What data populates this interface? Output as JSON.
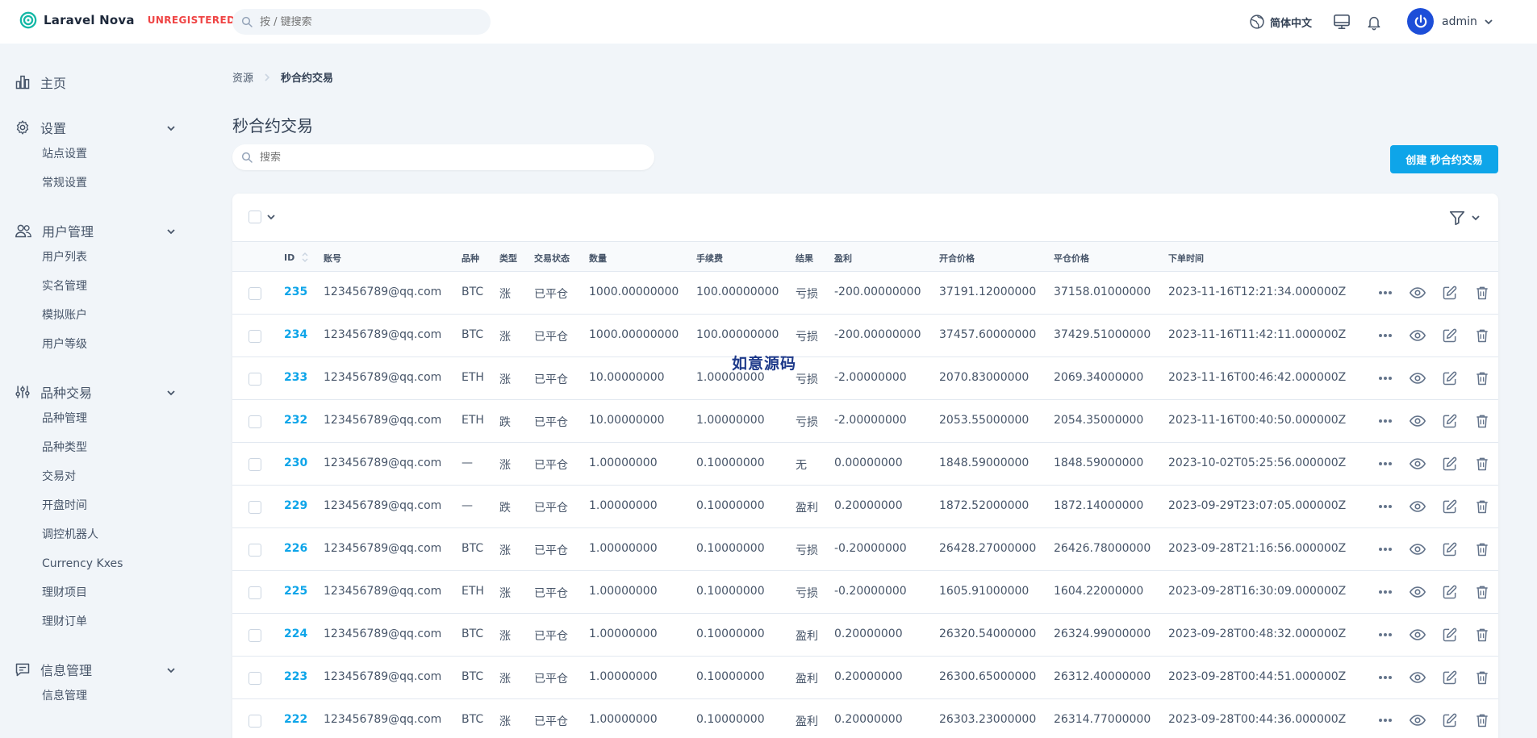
{
  "app": {
    "name": "Laravel Nova",
    "badge": "UNREGISTERED"
  },
  "topbar": {
    "search_placeholder": "按 / 键搜索",
    "language": "简体中文",
    "user_name": "admin"
  },
  "sidebar": {
    "groups": [
      {
        "label": "主页",
        "icon": "chart-bar-icon",
        "items": []
      },
      {
        "label": "设置",
        "icon": "gear-icon",
        "items": [
          "站点设置",
          "常规设置"
        ]
      },
      {
        "label": "用户管理",
        "icon": "users-icon",
        "items": [
          "用户列表",
          "实名管理",
          "模拟账户",
          "用户等级"
        ]
      },
      {
        "label": "品种交易",
        "icon": "sliders-icon",
        "items": [
          "品种管理",
          "品种类型",
          "交易对",
          "开盘时间",
          "调控机器人",
          "Currency Kxes",
          "理财项目",
          "理财订单"
        ]
      },
      {
        "label": "信息管理",
        "icon": "chat-icon",
        "items": [
          "信息管理"
        ]
      }
    ]
  },
  "breadcrumb": {
    "root": "资源",
    "current": "秒合约交易"
  },
  "page": {
    "title": "秒合约交易",
    "search_placeholder": "搜索",
    "create_label": "创建 秒合约交易"
  },
  "watermark": "如意源码",
  "table": {
    "columns": [
      "ID",
      "账号",
      "品种",
      "类型",
      "交易状态",
      "数量",
      "手续费",
      "结果",
      "盈利",
      "开合价格",
      "平仓价格",
      "下单时间"
    ],
    "rows": [
      [
        "235",
        "123456789@qq.com",
        "BTC",
        "涨",
        "已平仓",
        "1000.00000000",
        "100.00000000",
        "亏损",
        "-200.00000000",
        "37191.12000000",
        "37158.01000000",
        "2023-11-16T12:21:34.000000Z"
      ],
      [
        "234",
        "123456789@qq.com",
        "BTC",
        "涨",
        "已平仓",
        "1000.00000000",
        "100.00000000",
        "亏损",
        "-200.00000000",
        "37457.60000000",
        "37429.51000000",
        "2023-11-16T11:42:11.000000Z"
      ],
      [
        "233",
        "123456789@qq.com",
        "ETH",
        "涨",
        "已平仓",
        "10.00000000",
        "1.00000000",
        "亏损",
        "-2.00000000",
        "2070.83000000",
        "2069.34000000",
        "2023-11-16T00:46:42.000000Z"
      ],
      [
        "232",
        "123456789@qq.com",
        "ETH",
        "跌",
        "已平仓",
        "10.00000000",
        "1.00000000",
        "亏损",
        "-2.00000000",
        "2053.55000000",
        "2054.35000000",
        "2023-11-16T00:40:50.000000Z"
      ],
      [
        "230",
        "123456789@qq.com",
        "—",
        "涨",
        "已平仓",
        "1.00000000",
        "0.10000000",
        "无",
        "0.00000000",
        "1848.59000000",
        "1848.59000000",
        "2023-10-02T05:25:56.000000Z"
      ],
      [
        "229",
        "123456789@qq.com",
        "—",
        "跌",
        "已平仓",
        "1.00000000",
        "0.10000000",
        "盈利",
        "0.20000000",
        "1872.52000000",
        "1872.14000000",
        "2023-09-29T23:07:05.000000Z"
      ],
      [
        "226",
        "123456789@qq.com",
        "BTC",
        "涨",
        "已平仓",
        "1.00000000",
        "0.10000000",
        "亏损",
        "-0.20000000",
        "26428.27000000",
        "26426.78000000",
        "2023-09-28T21:16:56.000000Z"
      ],
      [
        "225",
        "123456789@qq.com",
        "ETH",
        "涨",
        "已平仓",
        "1.00000000",
        "0.10000000",
        "亏损",
        "-0.20000000",
        "1605.91000000",
        "1604.22000000",
        "2023-09-28T16:30:09.000000Z"
      ],
      [
        "224",
        "123456789@qq.com",
        "BTC",
        "涨",
        "已平仓",
        "1.00000000",
        "0.10000000",
        "盈利",
        "0.20000000",
        "26320.54000000",
        "26324.99000000",
        "2023-09-28T00:48:32.000000Z"
      ],
      [
        "223",
        "123456789@qq.com",
        "BTC",
        "涨",
        "已平仓",
        "1.00000000",
        "0.10000000",
        "盈利",
        "0.20000000",
        "26300.65000000",
        "26312.40000000",
        "2023-09-28T00:44:51.000000Z"
      ],
      [
        "222",
        "123456789@qq.com",
        "BTC",
        "涨",
        "已平仓",
        "1.00000000",
        "0.10000000",
        "盈利",
        "0.20000000",
        "26303.23000000",
        "26314.77000000",
        "2023-09-28T00:44:36.000000Z"
      ]
    ]
  },
  "colors": {
    "accent": "#0ea5e9",
    "badge": "#ef4444",
    "avatar": "#1d4ed8"
  }
}
